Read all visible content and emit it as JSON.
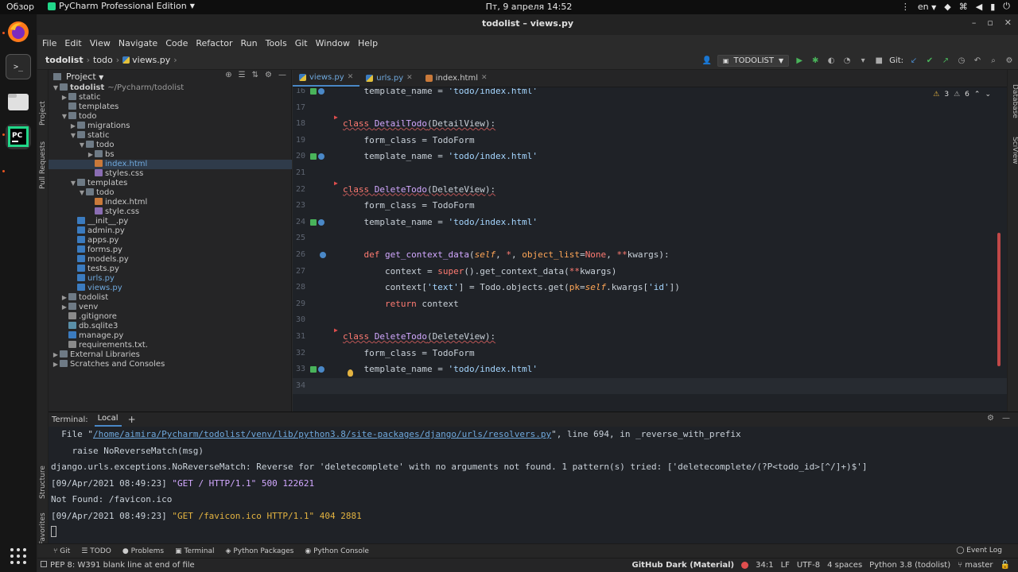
{
  "topbar": {
    "overview": "Обзор",
    "app_name": "PyCharm Professional Edition",
    "clock": "Пт, 9 апреля  14:52",
    "lang": "en"
  },
  "window": {
    "title": "todolist – views.py"
  },
  "menu": [
    "File",
    "Edit",
    "View",
    "Navigate",
    "Code",
    "Refactor",
    "Run",
    "Tools",
    "Git",
    "Window",
    "Help"
  ],
  "breadcrumb": {
    "root": "todolist",
    "mid": "todo",
    "file": "views.py"
  },
  "run_config": "TODOLIST",
  "git_label": "Git:",
  "side_tabs": {
    "project": "Project",
    "pull_requests": "Pull Requests",
    "structure": "Structure",
    "favorites": "Favorites",
    "database": "Database",
    "sciview": "SciView"
  },
  "project_panel": {
    "title": "Project",
    "tree": [
      {
        "label": "todolist",
        "extra": "~/Pycharm/todolist",
        "depth": 0,
        "arrow": "open",
        "icon": "folder",
        "bold": true
      },
      {
        "label": "static",
        "depth": 1,
        "arrow": "closed",
        "icon": "folder"
      },
      {
        "label": "templates",
        "depth": 1,
        "arrow": "",
        "icon": "folder"
      },
      {
        "label": "todo",
        "depth": 1,
        "arrow": "open",
        "icon": "folder"
      },
      {
        "label": "migrations",
        "depth": 2,
        "arrow": "closed",
        "icon": "folder"
      },
      {
        "label": "static",
        "depth": 2,
        "arrow": "open",
        "icon": "folder"
      },
      {
        "label": "todo",
        "depth": 3,
        "arrow": "open",
        "icon": "folder"
      },
      {
        "label": "bs",
        "depth": 4,
        "arrow": "closed",
        "icon": "folder"
      },
      {
        "label": "index.html",
        "depth": 4,
        "arrow": "",
        "icon": "html",
        "selected": true,
        "blue": true
      },
      {
        "label": "styles.css",
        "depth": 4,
        "arrow": "",
        "icon": "css"
      },
      {
        "label": "templates",
        "depth": 2,
        "arrow": "open",
        "icon": "folder"
      },
      {
        "label": "todo",
        "depth": 3,
        "arrow": "open",
        "icon": "folder"
      },
      {
        "label": "index.html",
        "depth": 4,
        "arrow": "",
        "icon": "html"
      },
      {
        "label": "style.css",
        "depth": 4,
        "arrow": "",
        "icon": "css"
      },
      {
        "label": "__init__.py",
        "depth": 2,
        "arrow": "",
        "icon": "py"
      },
      {
        "label": "admin.py",
        "depth": 2,
        "arrow": "",
        "icon": "py"
      },
      {
        "label": "apps.py",
        "depth": 2,
        "arrow": "",
        "icon": "py"
      },
      {
        "label": "forms.py",
        "depth": 2,
        "arrow": "",
        "icon": "py"
      },
      {
        "label": "models.py",
        "depth": 2,
        "arrow": "",
        "icon": "py"
      },
      {
        "label": "tests.py",
        "depth": 2,
        "arrow": "",
        "icon": "py"
      },
      {
        "label": "urls.py",
        "depth": 2,
        "arrow": "",
        "icon": "py",
        "blue": true
      },
      {
        "label": "views.py",
        "depth": 2,
        "arrow": "",
        "icon": "py",
        "blue": true
      },
      {
        "label": "todolist",
        "depth": 1,
        "arrow": "closed",
        "icon": "folder"
      },
      {
        "label": "venv",
        "depth": 1,
        "arrow": "closed",
        "icon": "folder"
      },
      {
        "label": ".gitignore",
        "depth": 1,
        "arrow": "",
        "icon": "txt"
      },
      {
        "label": "db.sqlite3",
        "depth": 1,
        "arrow": "",
        "icon": "db"
      },
      {
        "label": "manage.py",
        "depth": 1,
        "arrow": "",
        "icon": "py"
      },
      {
        "label": "requirements.txt.",
        "depth": 1,
        "arrow": "",
        "icon": "txt"
      },
      {
        "label": "External Libraries",
        "depth": 0,
        "arrow": "closed",
        "icon": "folder"
      },
      {
        "label": "Scratches and Consoles",
        "depth": 0,
        "arrow": "closed",
        "icon": "folder"
      }
    ]
  },
  "editor": {
    "tabs": [
      {
        "label": "views.py",
        "active": true,
        "icon": "py"
      },
      {
        "label": "urls.py",
        "active": false,
        "icon": "py"
      },
      {
        "label": "index.html",
        "active": false,
        "icon": "html"
      }
    ],
    "inspections": {
      "warnings": "3",
      "weak": "6"
    },
    "lines": [
      {
        "n": "16",
        "tokens": [
          [
            "",
            "    template_name = "
          ],
          [
            "str",
            "'todo/index.html'"
          ]
        ],
        "gutter": "green"
      },
      {
        "n": "17",
        "tokens": []
      },
      {
        "n": "18",
        "tokens": [
          [
            "kw und",
            "class "
          ],
          [
            "cls und",
            "DetailTodo"
          ],
          [
            "und",
            "(DetailView):"
          ]
        ],
        "flag": true
      },
      {
        "n": "19",
        "tokens": [
          [
            "",
            "    form_class = TodoForm"
          ]
        ]
      },
      {
        "n": "20",
        "tokens": [
          [
            "",
            "    template_name = "
          ],
          [
            "str",
            "'todo/index.html'"
          ]
        ],
        "gutter": "green"
      },
      {
        "n": "21",
        "tokens": []
      },
      {
        "n": "22",
        "tokens": [
          [
            "kw und",
            "class "
          ],
          [
            "cls und",
            "DeleteTodo"
          ],
          [
            "und",
            "(DeleteView):"
          ]
        ],
        "flag": true
      },
      {
        "n": "23",
        "tokens": [
          [
            "",
            "    form_class = TodoForm"
          ]
        ]
      },
      {
        "n": "24",
        "tokens": [
          [
            "",
            "    template_name = "
          ],
          [
            "str",
            "'todo/index.html'"
          ]
        ],
        "gutter": "green"
      },
      {
        "n": "25",
        "tokens": []
      },
      {
        "n": "26",
        "tokens": [
          [
            "kw",
            "    def "
          ],
          [
            "fn",
            "get_context_data"
          ],
          [
            "",
            "("
          ],
          [
            "slf",
            "self"
          ],
          [
            "",
            ", "
          ],
          [
            "kw",
            "*"
          ],
          [
            "",
            ", "
          ],
          [
            "par",
            "object_list"
          ],
          [
            "",
            "="
          ],
          [
            "kw",
            "None"
          ],
          [
            "",
            ", "
          ],
          [
            "kw",
            "**"
          ],
          [
            "",
            "kwargs):"
          ]
        ],
        "gutter": "blue"
      },
      {
        "n": "27",
        "tokens": [
          [
            "",
            "        context = "
          ],
          [
            "kw",
            "super"
          ],
          [
            "",
            "().get_context_data("
          ],
          [
            "kw",
            "**"
          ],
          [
            "",
            "kwargs)"
          ]
        ]
      },
      {
        "n": "28",
        "tokens": [
          [
            "",
            "        context["
          ],
          [
            "str",
            "'text'"
          ],
          [
            "",
            "] = Todo.objects.get("
          ],
          [
            "par",
            "pk"
          ],
          [
            "",
            "="
          ],
          [
            "slf",
            "self"
          ],
          [
            "",
            ".kwargs["
          ],
          [
            "str",
            "'id'"
          ],
          [
            "",
            "])"
          ]
        ]
      },
      {
        "n": "29",
        "tokens": [
          [
            "kw",
            "        return "
          ],
          [
            "",
            "context"
          ]
        ]
      },
      {
        "n": "30",
        "tokens": []
      },
      {
        "n": "31",
        "tokens": [
          [
            "kw und",
            "class "
          ],
          [
            "cls und",
            "DeleteTodo"
          ],
          [
            "und",
            "(DeleteView):"
          ]
        ],
        "flag": true
      },
      {
        "n": "32",
        "tokens": [
          [
            "",
            "    form_class = TodoForm"
          ]
        ]
      },
      {
        "n": "33",
        "tokens": [
          [
            "",
            "    template_name = "
          ],
          [
            "str",
            "'todo/index.html'"
          ]
        ],
        "gutter": "green",
        "bulb": true
      },
      {
        "n": "34",
        "tokens": [],
        "current": true
      }
    ]
  },
  "terminal": {
    "label": "Terminal:",
    "tab": "Local",
    "add": "+",
    "lines": [
      {
        "parts": [
          [
            "",
            "  File \""
          ],
          [
            "link",
            "/home/aimira/Pycharm/todolist/venv/lib/python3.8/site-packages/django/urls/resolvers.py"
          ],
          [
            "",
            "\", line 694, in _reverse_with_prefix"
          ]
        ]
      },
      {
        "parts": [
          [
            "",
            "    raise NoReverseMatch(msg)"
          ]
        ]
      },
      {
        "parts": [
          [
            "",
            "django.urls.exceptions.NoReverseMatch: Reverse for 'deletecomplete' with no arguments not found. 1 pattern(s) tried: ['deletecomplete/(?P<todo_id>[^/]+)$']"
          ]
        ]
      },
      {
        "parts": [
          [
            "",
            "[09/Apr/2021 08:49:23] "
          ],
          [
            "str",
            "\"GET / HTTP/1.1\" 500 122621"
          ]
        ]
      },
      {
        "parts": [
          [
            "",
            "Not Found: /favicon.ico"
          ]
        ]
      },
      {
        "parts": [
          [
            "",
            "[09/Apr/2021 08:49:23] "
          ],
          [
            "num",
            "\"GET /favicon.ico HTTP/1.1\" 404 2881"
          ]
        ]
      }
    ]
  },
  "tool_windows": [
    "Git",
    "TODO",
    "Problems",
    "Terminal",
    "Python Packages",
    "Python Console"
  ],
  "event_log": "Event Log",
  "status": {
    "message": "PEP 8: W391 blank line at end of file",
    "theme": "GitHub Dark (Material)",
    "position": "34:1",
    "line_sep": "LF",
    "encoding": "UTF-8",
    "indent": "4 spaces",
    "interpreter": "Python 3.8 (todolist)",
    "branch": "master"
  },
  "colors": {
    "accent": "#4a88c7",
    "error": "#e04e4e",
    "editor_bg": "#1f2227"
  }
}
